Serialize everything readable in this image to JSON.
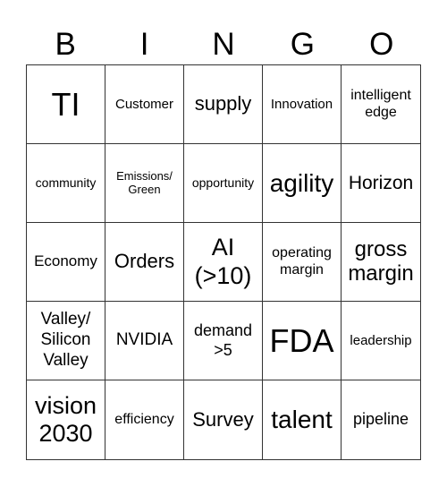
{
  "header": [
    "B",
    "I",
    "N",
    "G",
    "O"
  ],
  "cells": [
    {
      "text": "TI",
      "size": "s36"
    },
    {
      "text": "Customer",
      "size": "s15"
    },
    {
      "text": "supply",
      "size": "s22"
    },
    {
      "text": "Innovation",
      "size": "s15"
    },
    {
      "text": "intelligent\nedge",
      "size": "s16"
    },
    {
      "text": "community",
      "size": "s14"
    },
    {
      "text": "Emissions/\nGreen",
      "size": "s13"
    },
    {
      "text": "opportunity",
      "size": "s14"
    },
    {
      "text": "agility",
      "size": "s28"
    },
    {
      "text": "Horizon",
      "size": "s21"
    },
    {
      "text": "Economy",
      "size": "s17"
    },
    {
      "text": "Orders",
      "size": "s22"
    },
    {
      "text": "AI\n(>10)",
      "size": "s27"
    },
    {
      "text": "operating\nmargin",
      "size": "s16"
    },
    {
      "text": "gross\nmargin",
      "size": "s24"
    },
    {
      "text": "Valley/\nSilicon\nValley",
      "size": "s19"
    },
    {
      "text": "NVIDIA",
      "size": "s19"
    },
    {
      "text": "demand\n>5",
      "size": "s18"
    },
    {
      "text": "FDA",
      "size": "s36"
    },
    {
      "text": "leadership",
      "size": "s15"
    },
    {
      "text": "vision\n2030",
      "size": "s27"
    },
    {
      "text": "efficiency",
      "size": "s16"
    },
    {
      "text": "Survey",
      "size": "s22"
    },
    {
      "text": "talent",
      "size": "s28"
    },
    {
      "text": "pipeline",
      "size": "s18"
    }
  ]
}
